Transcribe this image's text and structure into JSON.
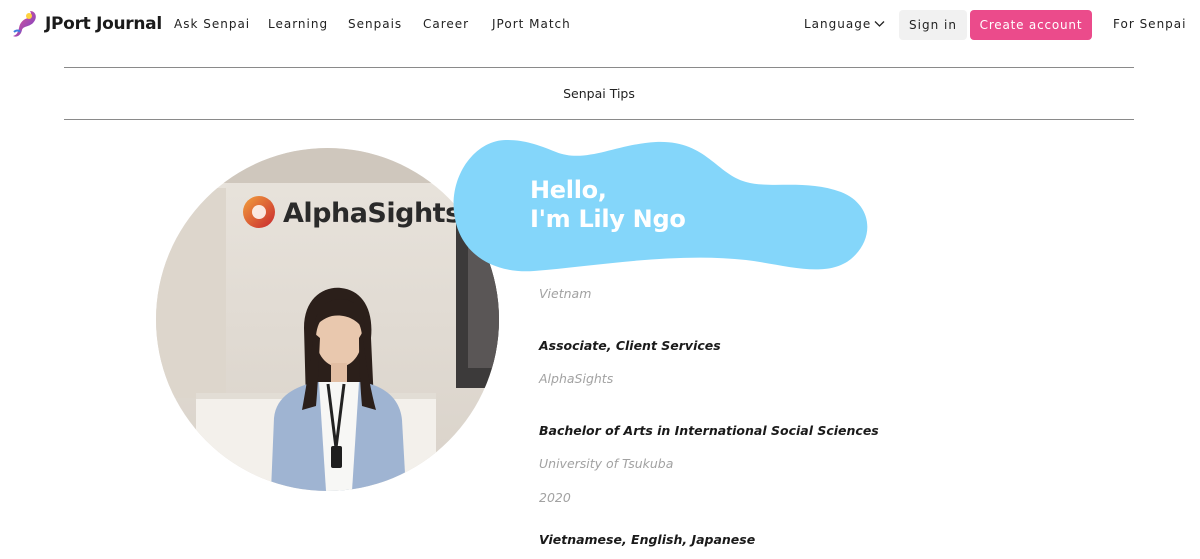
{
  "header": {
    "logo_text": "JPort Journal",
    "nav": [
      "Ask Senpai",
      "Learning",
      "Senpais",
      "Career",
      "JPort Match"
    ],
    "language_label": "Language",
    "sign_in_label": "Sign in",
    "create_account_label": "Create account",
    "for_senpai_label": "For Senpai"
  },
  "section": {
    "tab_label": "Senpai Tips"
  },
  "photo": {
    "sign_text": "AlphaSights"
  },
  "profile": {
    "greeting_line1": "Hello,",
    "greeting_line2": "I'm Lily Ngo",
    "country": "Vietnam",
    "position": "Associate, Client Services",
    "company": "AlphaSights",
    "degree": "Bachelor of Arts in International Social Sciences",
    "university": "University of Tsukuba",
    "year": "2020",
    "languages": "Vietnamese, English, Japanese"
  },
  "colors": {
    "accent_pink": "#eb4b8b",
    "blob_blue": "#84d6fa",
    "text_dark": "#1a1a1a",
    "text_muted": "#a2a2a2"
  }
}
